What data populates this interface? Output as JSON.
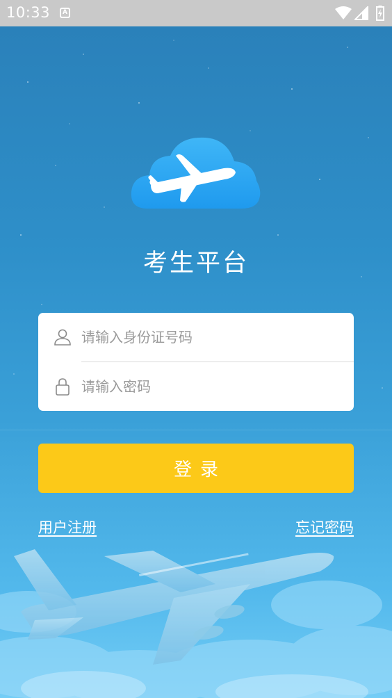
{
  "status_bar": {
    "time": "10:33",
    "notification_icon": "a-icon",
    "wifi_icon": "wifi-icon",
    "signal_icon": "signal-icon",
    "battery_icon": "battery-charging-icon"
  },
  "app": {
    "title": "考生平台",
    "logo_icon": "cloud-airplane-icon"
  },
  "login_form": {
    "id_field": {
      "placeholder": "请输入身份证号码",
      "value": "",
      "icon": "user-icon"
    },
    "password_field": {
      "placeholder": "请输入密码",
      "value": "",
      "icon": "lock-icon"
    },
    "login_button_label": "登录"
  },
  "links": {
    "register_label": "用户注册",
    "forgot_password_label": "忘记密码"
  },
  "colors": {
    "background_top": "#2a7fb8",
    "background_bottom": "#74cdf6",
    "login_button": "#fcc918",
    "card_background": "#ffffff",
    "logo_cloud": "#32a8f2"
  }
}
